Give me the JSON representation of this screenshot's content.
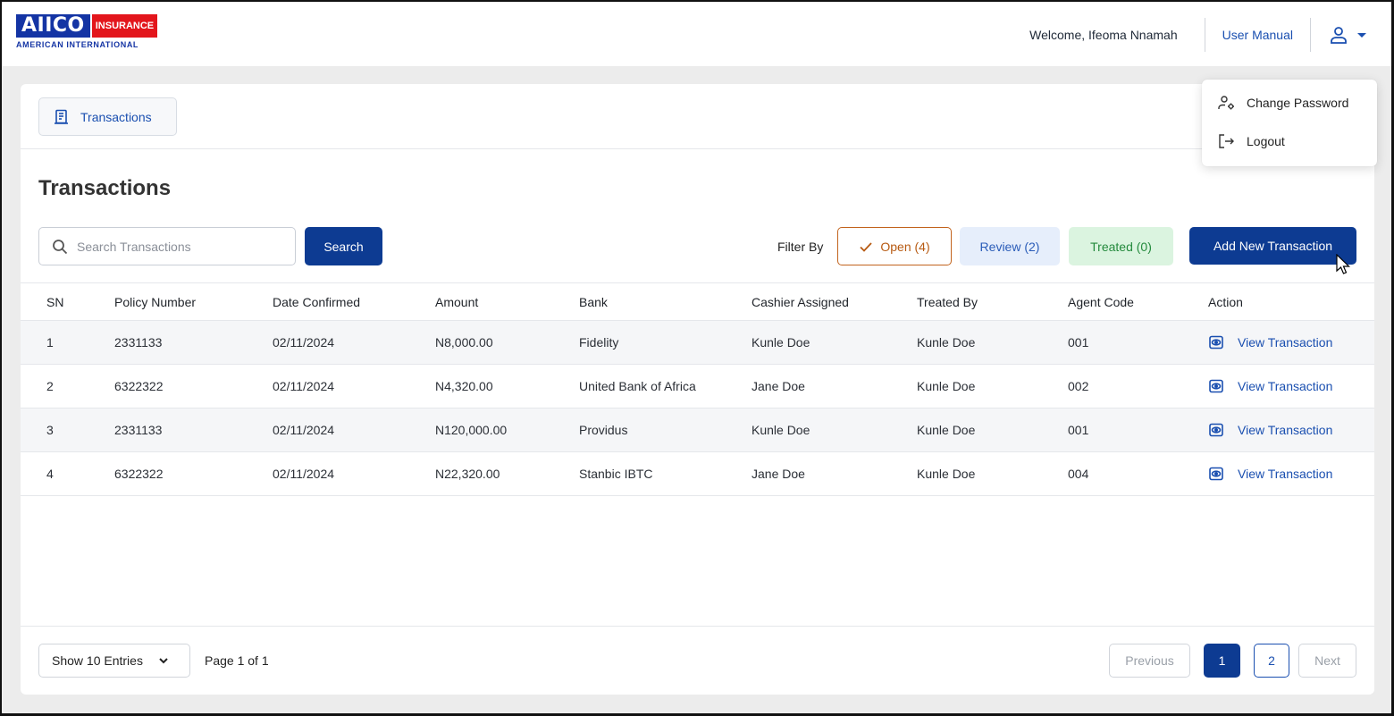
{
  "brand": {
    "logo_main": "AIICO",
    "logo_tag": "INSURANCE",
    "logo_sub": "AMERICAN INTERNATIONAL",
    "primary": "#0d3b92",
    "logo_blue": "#1434a4",
    "logo_red": "#e3161c"
  },
  "header": {
    "welcome": "Welcome,  Ifeoma Nnamah",
    "user_manual": "User Manual",
    "user_icon": "user-icon",
    "caret_icon": "caret-down-icon"
  },
  "user_menu": {
    "items": [
      {
        "label": "Change Password",
        "icon": "user-settings-icon"
      },
      {
        "label": "Logout",
        "icon": "logout-icon"
      }
    ]
  },
  "breadcrumb": {
    "label": "Transactions",
    "icon": "receipt-icon"
  },
  "page": {
    "title": "Transactions"
  },
  "search": {
    "placeholder": "Search Transactions",
    "value": "",
    "button": "Search"
  },
  "filters": {
    "label": "Filter By",
    "open": "Open (4)",
    "review": "Review (2)",
    "treated": "Treated (0)",
    "open_color": "#c2631d",
    "review_color": "#2a5cb8",
    "treated_color": "#248a3d"
  },
  "add_button": "Add New Transaction",
  "table": {
    "headers": [
      "SN",
      "Policy Number",
      "Date Confirmed",
      "Amount",
      "Bank",
      "Cashier Assigned",
      "Treated By",
      "Agent Code",
      "Action"
    ],
    "rows": [
      [
        "1",
        "2331133",
        "02/11/2024",
        "N8,000.00",
        "Fidelity",
        "Kunle Doe",
        "Kunle Doe",
        "001",
        "View Transaction"
      ],
      [
        "2",
        "6322322",
        "02/11/2024",
        "N4,320.00",
        "United Bank of Africa",
        "Jane Doe",
        "Kunle Doe",
        "002",
        "View Transaction"
      ],
      [
        "3",
        "2331133",
        "02/11/2024",
        "N120,000.00",
        "Providus",
        "Kunle Doe",
        "Kunle Doe",
        "001",
        "View Transaction"
      ],
      [
        "4",
        "6322322",
        "02/11/2024",
        "N22,320.00",
        "Stanbic IBTC",
        "Jane Doe",
        "Kunle Doe",
        "004",
        "View Transaction"
      ]
    ]
  },
  "pagination": {
    "entries": "Show 10 Entries",
    "page_info": "Page 1 of 1",
    "previous": "Previous",
    "pages": [
      "1",
      "2"
    ],
    "next": "Next"
  }
}
